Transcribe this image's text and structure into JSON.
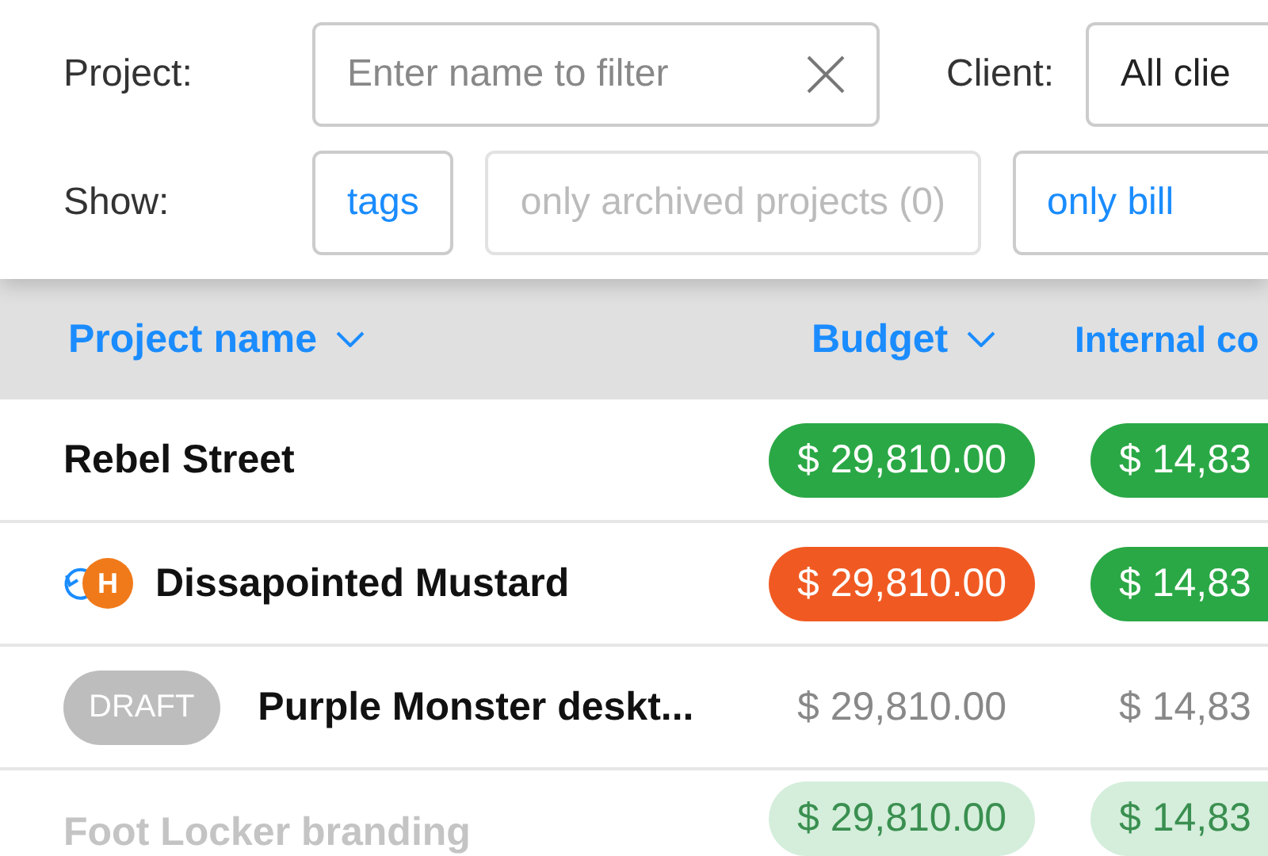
{
  "filters": {
    "project_label": "Project:",
    "project_field": {
      "placeholder": "Enter name to filter"
    },
    "client_label": "Client:",
    "client_select": {
      "value": "All clie"
    },
    "show_label": "Show:",
    "show_options": [
      {
        "label": "tags",
        "disabled": false
      },
      {
        "label": "only archived projects (0)",
        "disabled": true
      },
      {
        "label": "only bill",
        "disabled": false
      }
    ]
  },
  "table": {
    "columns": [
      {
        "label": "Project name",
        "sortable": true
      },
      {
        "label": "Budget",
        "sortable": true
      },
      {
        "label": "Internal co",
        "sortable": false
      }
    ],
    "rows": [
      {
        "name": "Rebel Street",
        "kind": "normal",
        "recurring": false,
        "budget": {
          "text": "$ 29,810.00",
          "kind": "ok"
        },
        "internal": {
          "text": "$ 14,83",
          "kind": "ok"
        }
      },
      {
        "name": "Dissapointed Mustard",
        "kind": "normal",
        "recurring": true,
        "avatar": "H",
        "budget": {
          "text": "$ 29,810.00",
          "kind": "over"
        },
        "internal": {
          "text": "$ 14,83",
          "kind": "ok"
        }
      },
      {
        "name": "Purple Monster deskt...",
        "kind": "draft",
        "badge": "DRAFT",
        "recurring": false,
        "budget": {
          "text": "$ 29,810.00",
          "kind": "plain"
        },
        "internal": {
          "text": "$ 14,83",
          "kind": "plain"
        }
      },
      {
        "name": "Foot Locker branding",
        "kind": "faded",
        "recurring": false,
        "budget": {
          "text": "$ 29,810.00",
          "kind": "ok"
        },
        "internal": {
          "text": "$ 14,83",
          "kind": "ok"
        }
      }
    ]
  }
}
